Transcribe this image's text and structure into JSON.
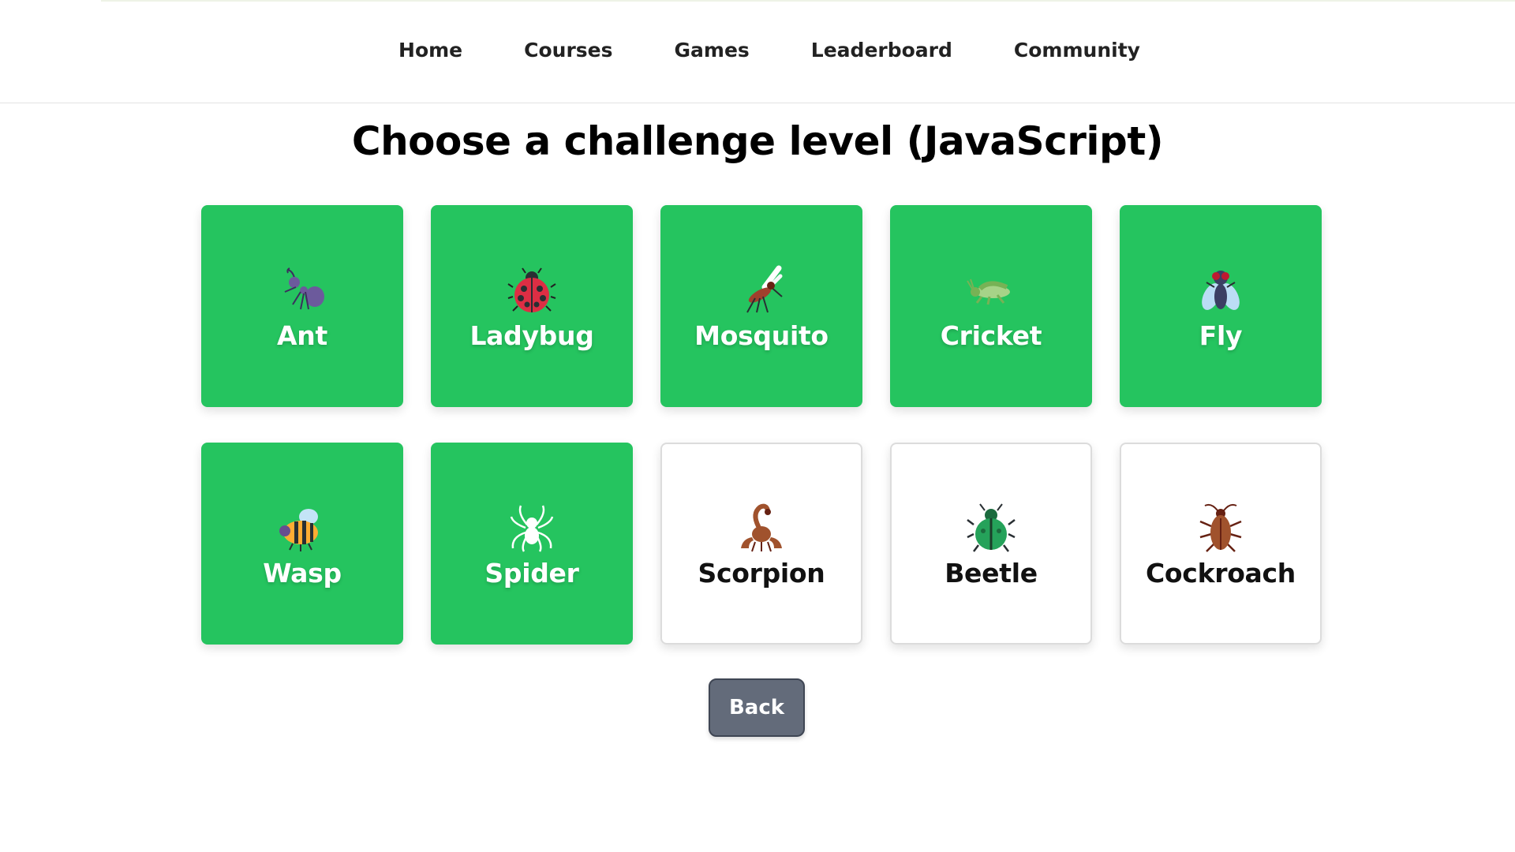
{
  "nav": {
    "items": [
      {
        "label": "Home"
      },
      {
        "label": "Courses"
      },
      {
        "label": "Games"
      },
      {
        "label": "Leaderboard"
      },
      {
        "label": "Community"
      }
    ]
  },
  "page": {
    "title": "Choose a challenge level (JavaScript)"
  },
  "levels": [
    {
      "label": "Ant",
      "icon": "ant-icon",
      "status": "completed"
    },
    {
      "label": "Ladybug",
      "icon": "ladybug-icon",
      "status": "completed"
    },
    {
      "label": "Mosquito",
      "icon": "mosquito-icon",
      "status": "completed"
    },
    {
      "label": "Cricket",
      "icon": "cricket-icon",
      "status": "completed"
    },
    {
      "label": "Fly",
      "icon": "fly-icon",
      "status": "completed"
    },
    {
      "label": "Wasp",
      "icon": "wasp-icon",
      "status": "completed"
    },
    {
      "label": "Spider",
      "icon": "spider-icon",
      "status": "completed"
    },
    {
      "label": "Scorpion",
      "icon": "scorpion-icon",
      "status": "locked"
    },
    {
      "label": "Beetle",
      "icon": "beetle-icon",
      "status": "locked"
    },
    {
      "label": "Cockroach",
      "icon": "cockroach-icon",
      "status": "locked"
    }
  ],
  "actions": {
    "back_label": "Back"
  },
  "colors": {
    "completed_card": "#25c45f",
    "locked_card": "#ffffff",
    "back_button": "#636b7a"
  }
}
